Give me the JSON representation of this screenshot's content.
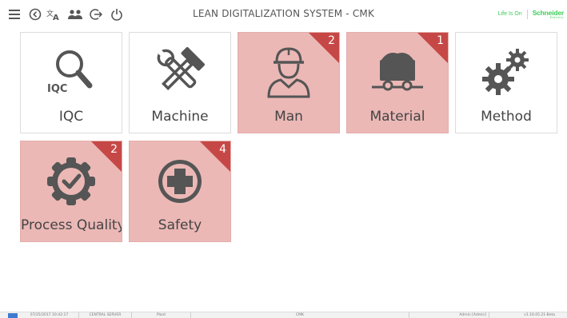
{
  "header": {
    "title": "LEAN DIGITALIZATION SYSTEM - CMK",
    "brand_tagline": "Life Is On",
    "brand_name": "Schneider",
    "brand_sub": "Electric",
    "brand_color": "#3dcd58"
  },
  "toolbar": {
    "icons": [
      "menu-icon",
      "back-icon",
      "translate-icon",
      "users-icon",
      "logout-icon",
      "power-icon"
    ]
  },
  "tiles": [
    {
      "label": "IQC",
      "icon": "magnifier-iqc-icon",
      "icon_text": "IQC",
      "badge": "",
      "alert": false
    },
    {
      "label": "Machine",
      "icon": "tools-icon",
      "badge": "",
      "alert": false
    },
    {
      "label": "Man",
      "icon": "worker-icon",
      "badge": "2",
      "alert": true
    },
    {
      "label": "Material",
      "icon": "mine-cart-icon",
      "badge": "1",
      "alert": true
    },
    {
      "label": "Method",
      "icon": "gears-icon",
      "badge": "",
      "alert": false
    },
    {
      "label": "Process Quality",
      "icon": "quality-check-icon",
      "badge": "2",
      "alert": true
    },
    {
      "label": "Safety",
      "icon": "first-aid-cross-icon",
      "badge": "4",
      "alert": true
    }
  ],
  "colors": {
    "alert_tile_bg": "#ebb8b6",
    "badge_bg": "#c64846",
    "icon_gray": "#555555"
  },
  "statusbar": {
    "datetime": "07/25/2017 10:42:17",
    "server": "CENTRAL SERVER",
    "area": "Plant",
    "site": "CMK",
    "user": "Admin [Admin]",
    "version": "v1.16.05.21-Beta"
  }
}
